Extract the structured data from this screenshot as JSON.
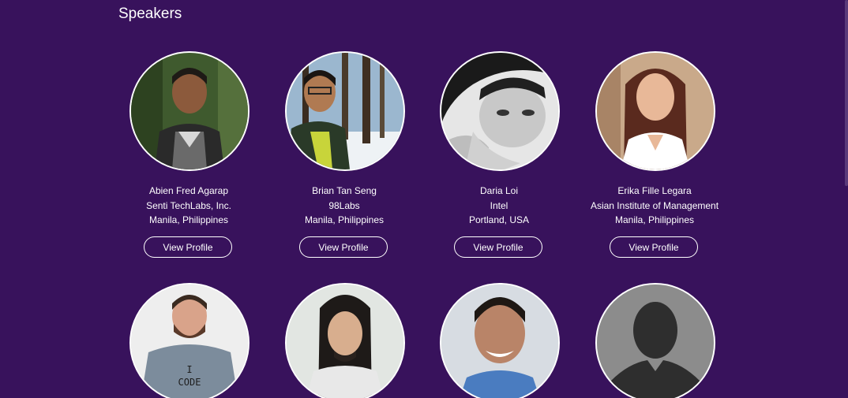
{
  "section": {
    "title": "Speakers"
  },
  "speakers": [
    {
      "name": "Abien Fred Agarap",
      "company": "Senti TechLabs, Inc.",
      "location": "Manila, Philippines",
      "button": "View Profile"
    },
    {
      "name": "Brian Tan Seng",
      "company": "98Labs",
      "location": "Manila, Philippines",
      "button": "View Profile"
    },
    {
      "name": "Daria Loi",
      "company": "Intel",
      "location": "Portland, USA",
      "button": "View Profile"
    },
    {
      "name": "Erika Fille Legara",
      "company": "Asian Institute of Management",
      "location": "Manila, Philippines",
      "button": "View Profile"
    }
  ],
  "shirt_text": {
    "line1": "I",
    "line2": "CODE"
  },
  "colors": {
    "background": "#38125c",
    "text": "#ffffff",
    "border": "#ffffff"
  }
}
